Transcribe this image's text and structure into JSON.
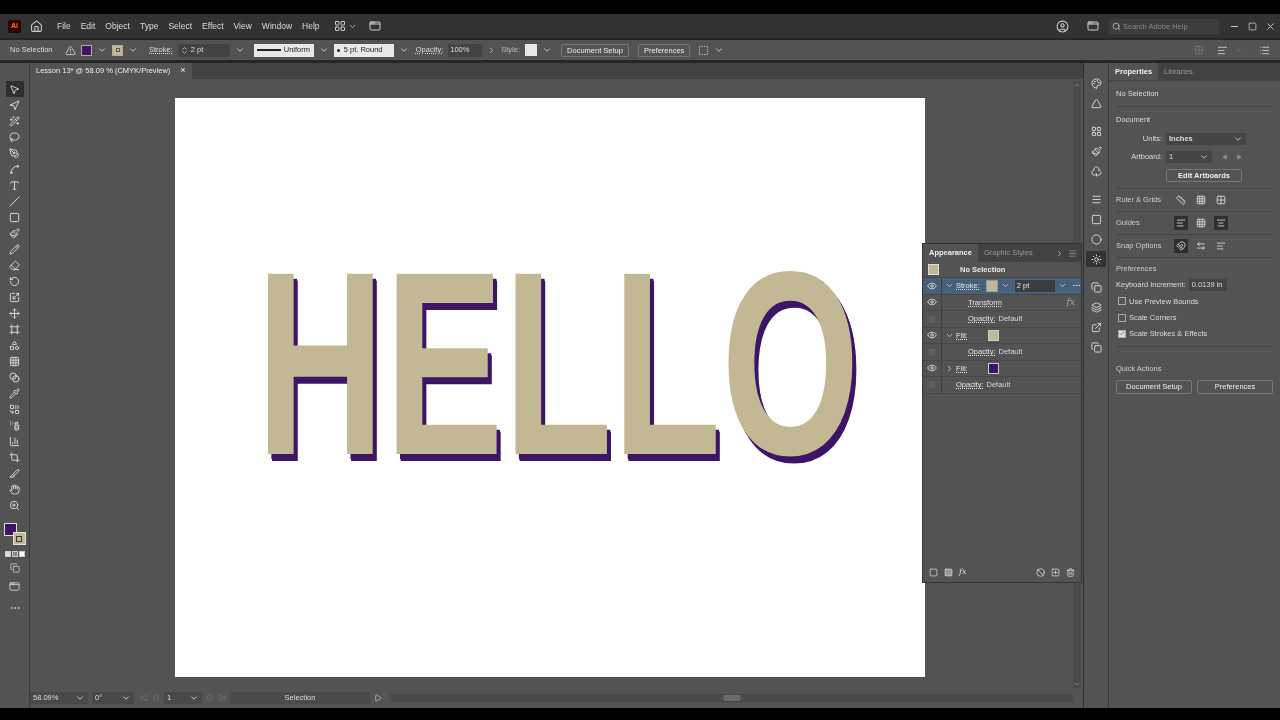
{
  "app": {
    "logo": "Ai"
  },
  "menu": [
    "File",
    "Edit",
    "Object",
    "Type",
    "Select",
    "Effect",
    "View",
    "Window",
    "Help"
  ],
  "search": {
    "placeholder": "Search Adobe Help"
  },
  "control_bar": {
    "selection": "No Selection",
    "stroke_label": "Stroke:",
    "stroke_weight": "2 pt",
    "profile": "Uniform",
    "brush": "5 pt. Round",
    "opacity_label": "Opacity:",
    "opacity": "100%",
    "style_label": "Style:",
    "buttons": [
      "Document Setup",
      "Preferences"
    ]
  },
  "document_tab": {
    "title": "Lesson 13* @ 58.09 % (CMYK/Preview)",
    "close": "×"
  },
  "tools": [
    {
      "selected": true
    },
    {
      "selected": false
    },
    {
      "selected": false
    },
    {
      "selected": false
    },
    {
      "selected": false
    },
    {
      "selected": false
    },
    {
      "selected": false
    },
    {
      "selected": false
    },
    {
      "selected": false
    },
    {
      "selected": false
    },
    {
      "selected": false
    },
    {
      "selected": false
    },
    {
      "selected": false
    },
    {
      "selected": false
    },
    {
      "selected": false
    },
    {
      "selected": false
    },
    {
      "selected": false
    },
    {
      "selected": false
    },
    {
      "selected": false
    },
    {
      "selected": false
    },
    {
      "selected": false
    },
    {
      "selected": false
    },
    {
      "selected": false
    },
    {
      "selected": false
    },
    {
      "selected": false
    },
    {
      "selected": false
    },
    {
      "selected": false
    }
  ],
  "artwork": {
    "text": "HELLO"
  },
  "appearance": {
    "effect_button": "fx",
    "tabs": [
      {
        "label": "Appearance",
        "selected": true
      },
      {
        "label": "Graphic Styles",
        "selected": false
      }
    ],
    "title": "No Selection",
    "rows": [
      {
        "kind": "stroke",
        "label": "Stroke:",
        "color": "#c2b994",
        "value": "2 pt",
        "visible": true,
        "expanded": true,
        "selected": true,
        "children": [
          {
            "kind": "effect",
            "label": "Transform",
            "badge": "fx",
            "visible": true,
            "selected": false
          },
          {
            "kind": "opacity",
            "label": "Opacity:",
            "value": "Default",
            "visible": false,
            "selected": false
          }
        ]
      },
      {
        "kind": "fill",
        "label": "Fill:",
        "color": "#c2b994",
        "visible": true,
        "expanded": true,
        "selected": false,
        "children": [
          {
            "kind": "opacity",
            "label": "Opacity:",
            "value": "Default",
            "visible": false,
            "selected": false
          }
        ]
      },
      {
        "kind": "fill",
        "label": "Fill:",
        "color": "#3d1466",
        "visible": true,
        "expanded": false,
        "selected": false
      },
      {
        "kind": "opacity",
        "label": "Opacity:",
        "value": "Default",
        "visible": false,
        "selected": false
      }
    ]
  },
  "panel_icons": [
    {
      "selected": false
    },
    {
      "selected": false
    },
    {
      "selected": false
    },
    {
      "selected": false
    },
    {
      "selected": false
    },
    {
      "selected": false
    },
    {
      "selected": false
    },
    {
      "selected": false
    },
    {
      "selected": true
    },
    {
      "selected": false
    },
    {
      "selected": false
    },
    {
      "selected": false
    },
    {
      "selected": false
    }
  ],
  "properties": {
    "tabs": [
      {
        "label": "Properties",
        "selected": true
      },
      {
        "label": "Libraries",
        "selected": false
      }
    ],
    "selection": "No Selection",
    "document": {
      "heading": "Document",
      "units_label": "Units:",
      "units": "Inches",
      "artboard_label": "Artboard:",
      "artboard": "1",
      "edit_button": "Edit Artboards"
    },
    "sections": [
      {
        "label": "Ruler & Grids",
        "toggles": [
          {
            "on": false
          },
          {
            "on": false
          },
          {
            "on": false
          }
        ]
      },
      {
        "label": "Guides",
        "toggles": [
          {
            "on": true
          },
          {
            "on": false
          },
          {
            "on": true
          }
        ]
      },
      {
        "label": "Snap Options",
        "toggles": [
          {
            "on": true
          },
          {
            "on": false
          },
          {
            "on": false
          }
        ]
      }
    ],
    "preferences": {
      "heading": "Preferences",
      "increment_label": "Keyboard Increment:",
      "increment": "0.0139 in",
      "checkboxes": [
        {
          "label": "Use Preview Bounds",
          "checked": false
        },
        {
          "label": "Scale Corners",
          "checked": false
        },
        {
          "label": "Scale Strokes & Effects",
          "checked": true
        }
      ]
    },
    "quick_actions": {
      "heading": "Quick Actions",
      "buttons": [
        "Document Setup",
        "Preferences"
      ]
    }
  },
  "status_bar": {
    "zoom": "58.09%",
    "rotation": "0°",
    "artboard": "1",
    "tool": "Selection"
  }
}
